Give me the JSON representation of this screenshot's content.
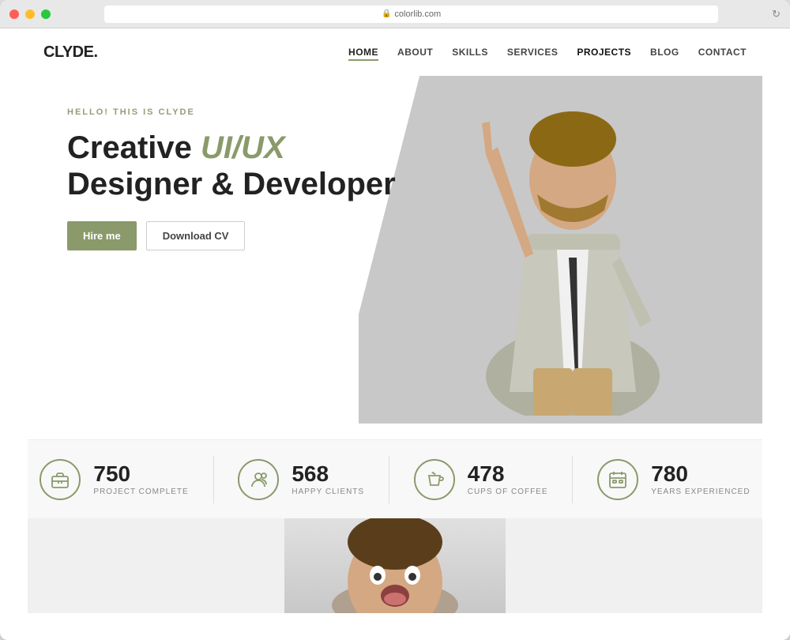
{
  "browser": {
    "url": "colorlib.com",
    "traffic_lights": [
      "red",
      "yellow",
      "green"
    ]
  },
  "nav": {
    "logo": "CLYDE.",
    "links": [
      {
        "label": "HOME",
        "active": true
      },
      {
        "label": "ABOUT",
        "active": false
      },
      {
        "label": "SKILLS",
        "active": false
      },
      {
        "label": "SERVICES",
        "active": false
      },
      {
        "label": "PROJECTS",
        "active": false
      },
      {
        "label": "BLOG",
        "active": false
      },
      {
        "label": "CONTACT",
        "active": false
      }
    ]
  },
  "hero": {
    "subtitle": "HELLO! THIS IS CLYDE",
    "title_line1": "Creative UI/UX",
    "title_line2": "Designer & Developer",
    "btn_hire": "Hire me",
    "btn_download": "Download CV"
  },
  "stats": [
    {
      "number": "750",
      "label": "PROJECT COMPLETE",
      "icon": "briefcase"
    },
    {
      "number": "568",
      "label": "HAPPY CLIENTS",
      "icon": "clients"
    },
    {
      "number": "478",
      "label": "CUPS OF COFFEE",
      "icon": "coffee"
    },
    {
      "number": "780",
      "label": "YEARS EXPERIENCED",
      "icon": "calendar"
    }
  ],
  "colors": {
    "accent": "#8a9a6a",
    "text_dark": "#222222",
    "text_light": "#888888",
    "hero_gray": "#c5c5c5"
  }
}
